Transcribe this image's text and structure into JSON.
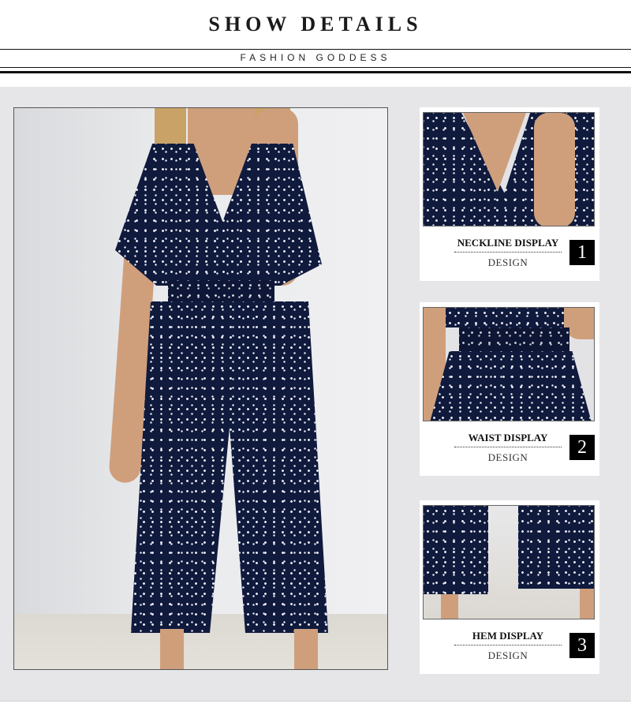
{
  "header": {
    "title": "SHOW DETAILS",
    "subtitle": "FASHION GODDESS"
  },
  "main_photo": {
    "icon": "jumpsuit-model-photo"
  },
  "details": [
    {
      "title": "NECKLINE DISPLAY",
      "subtitle": "DESIGN",
      "number": "1",
      "icon": "neckline-photo"
    },
    {
      "title": "WAIST DISPLAY",
      "subtitle": "DESIGN",
      "number": "2",
      "icon": "waist-photo"
    },
    {
      "title": "HEM DISPLAY",
      "subtitle": "DESIGN",
      "number": "3",
      "icon": "hem-photo"
    }
  ],
  "colors": {
    "panel_background": "#e6e6e9",
    "fabric": "#0f1a3d",
    "badge": "#000000"
  }
}
